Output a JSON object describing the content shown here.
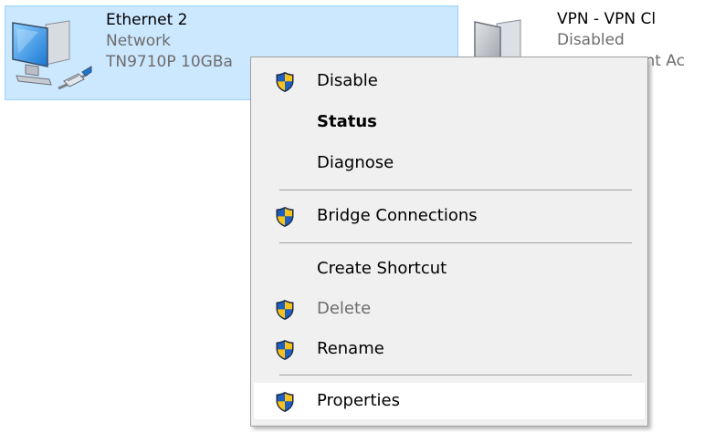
{
  "connections": [
    {
      "name": "Ethernet 2",
      "status": "Network",
      "device": "TN9710P 10GBa",
      "icon": "network-adapter-icon",
      "selected": true
    },
    {
      "name": "VPN - VPN Cl",
      "status": "Disabled",
      "device": "ent Ac",
      "icon": "vpn-adapter-icon",
      "selected": false
    }
  ],
  "context_menu": {
    "items": [
      {
        "label": "Disable",
        "icon": "uac-shield-icon",
        "bold": false,
        "enabled": true
      },
      {
        "label": "Status",
        "icon": "",
        "bold": true,
        "enabled": true
      },
      {
        "label": "Diagnose",
        "icon": "",
        "bold": false,
        "enabled": true
      },
      {
        "label": "Bridge Connections",
        "icon": "uac-shield-icon",
        "bold": false,
        "enabled": true
      },
      {
        "label": "Create Shortcut",
        "icon": "",
        "bold": false,
        "enabled": true
      },
      {
        "label": "Delete",
        "icon": "uac-shield-icon",
        "bold": false,
        "enabled": false
      },
      {
        "label": "Rename",
        "icon": "uac-shield-icon",
        "bold": false,
        "enabled": true
      },
      {
        "label": "Properties",
        "icon": "uac-shield-icon",
        "bold": false,
        "enabled": true,
        "highlighted": true
      }
    ]
  },
  "colors": {
    "selection_fill": "#cce8ff",
    "selection_border": "#99d1ff",
    "menu_background": "#f0f0f0",
    "menu_hover": "#ffffff",
    "shield_blue": "#1f5fbf",
    "shield_yellow": "#f6c21b",
    "disabled_text": "#6d6d6d"
  }
}
